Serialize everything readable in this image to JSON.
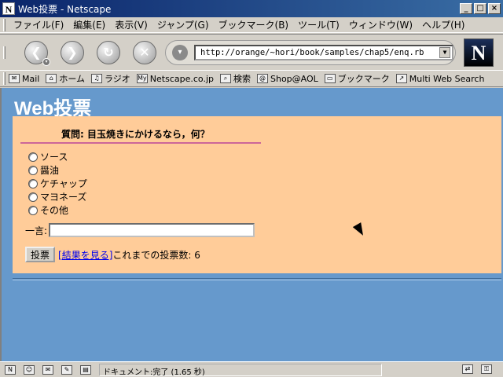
{
  "window": {
    "title": "Web投票 - Netscape",
    "icon": "N"
  },
  "menu": [
    "ファイル(F)",
    "編集(E)",
    "表示(V)",
    "ジャンプ(G)",
    "ブックマーク(B)",
    "ツール(T)",
    "ウィンドウ(W)",
    "ヘルプ(H)"
  ],
  "navigation": {
    "url": "http://orange/~hori/book/samples/chap5/enq.rb",
    "logo": "N"
  },
  "personal_toolbar": [
    "Mail",
    "ホーム",
    "ラジオ",
    "Netscape.co.jp",
    "検索",
    "Shop@AOL",
    "ブックマーク",
    "Multi Web Search"
  ],
  "page": {
    "title": "Web投票",
    "question": "質問: 目玉焼きにかけるなら，何？",
    "options": [
      "ソース",
      "醤油",
      "ケチャップ",
      "マヨネーズ",
      "その他"
    ],
    "comment_label": "一言:",
    "vote_button": "投票",
    "results_link": "[結果を見る]",
    "vote_count_text": "これまでの投票数: 6"
  },
  "status": {
    "text": "ドキュメント:完了 (1.65 秒)"
  }
}
